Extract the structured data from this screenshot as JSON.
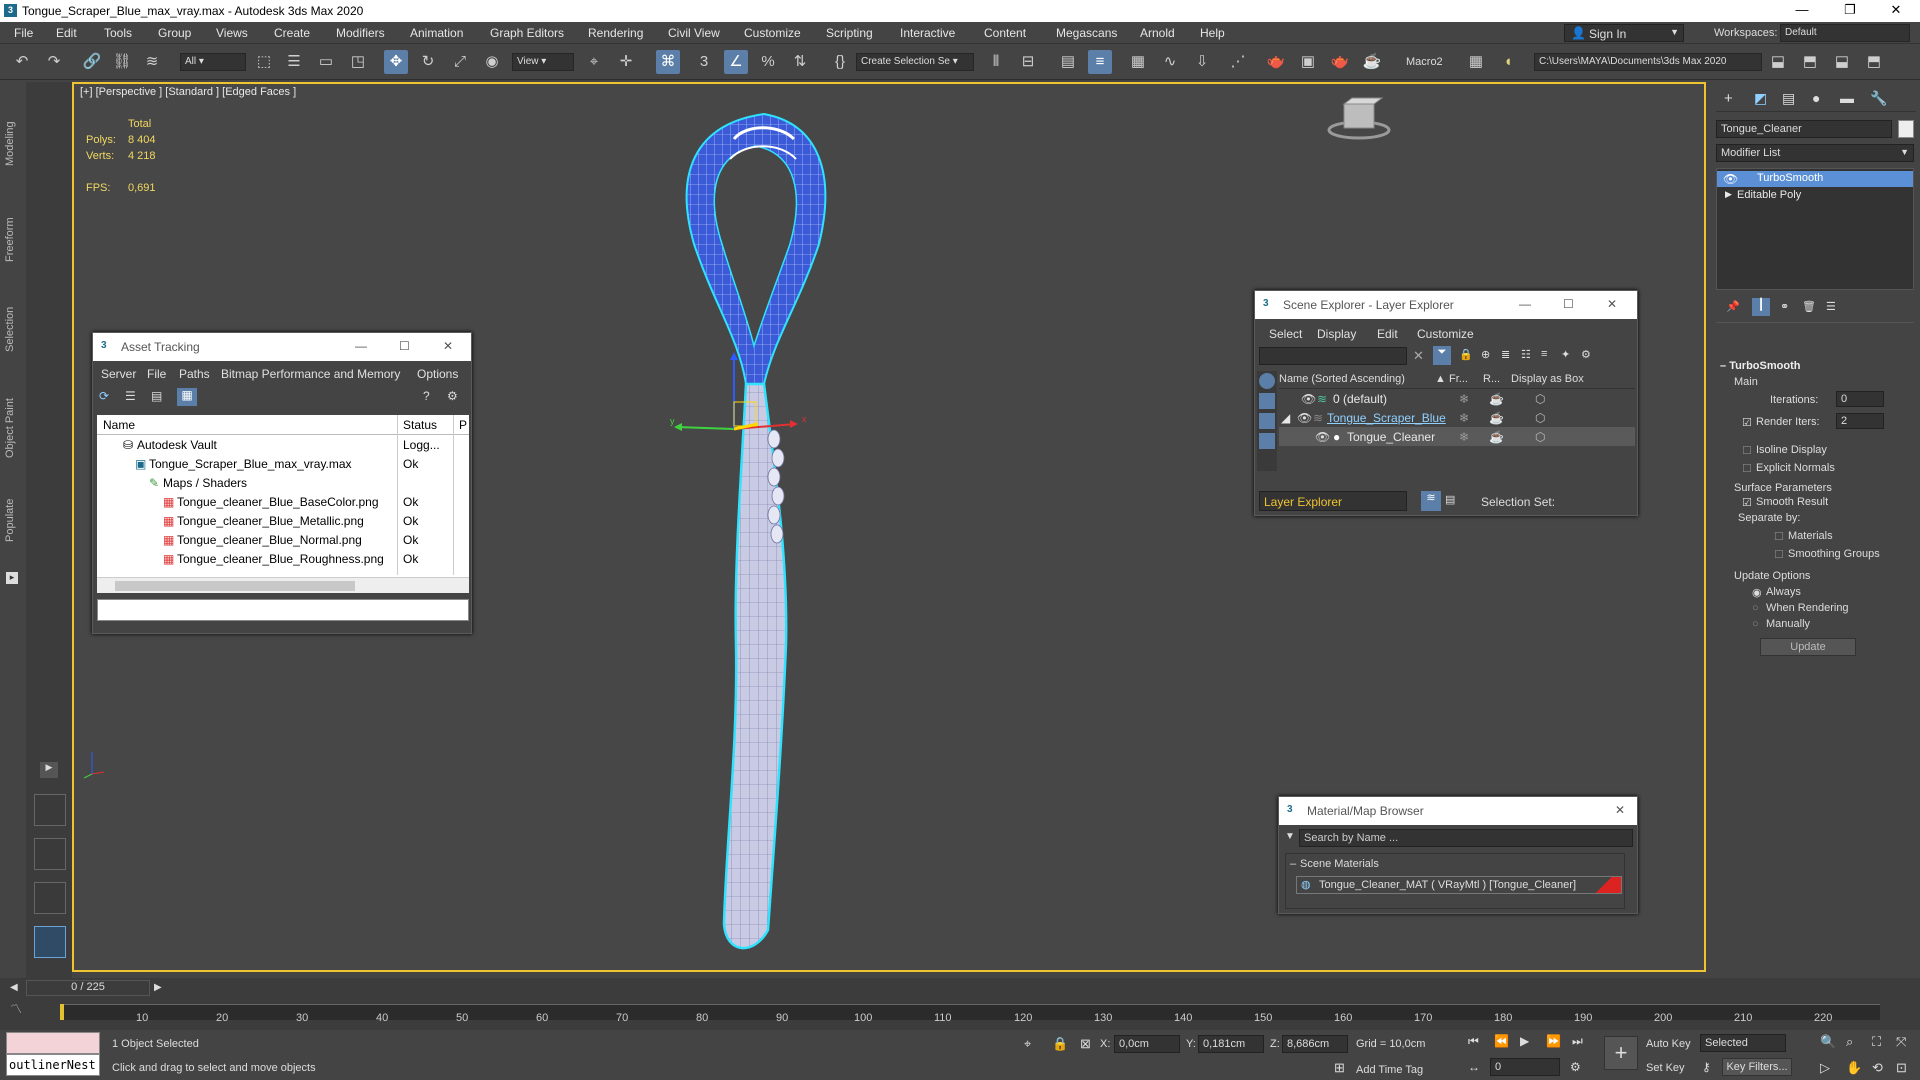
{
  "window": {
    "title": "Tongue_Scraper_Blue_max_vray.max - Autodesk 3ds Max 2020"
  },
  "menu": [
    "File",
    "Edit",
    "Tools",
    "Group",
    "Views",
    "Create",
    "Modifiers",
    "Animation",
    "Graph Editors",
    "Rendering",
    "Civil View",
    "Customize",
    "Scripting",
    "Interactive",
    "Content",
    "Megascans",
    "Arnold",
    "Help"
  ],
  "signin": "Sign In",
  "workspaces_label": "Workspaces:",
  "workspace": "Default",
  "toolbar": {
    "filter": "All",
    "view": "View",
    "selection_set": "Create Selection Se",
    "macro": "Macro2",
    "path": "C:\\Users\\MAYA\\Documents\\3ds Max 2020"
  },
  "side_tabs": [
    "Modeling",
    "Freeform",
    "Selection",
    "Object Paint",
    "Populate"
  ],
  "viewport": {
    "label": "[+] [Perspective ] [Standard ] [Edged Faces ]",
    "stats": {
      "total": "Total",
      "polys_label": "Polys:",
      "polys": "8 404",
      "verts_label": "Verts:",
      "verts": "4 218",
      "fps_label": "FPS:",
      "fps": "0,691"
    }
  },
  "command_panel": {
    "object_name": "Tongue_Cleaner",
    "modifier_list": "Modifier List",
    "stack": [
      "TurboSmooth",
      "Editable Poly"
    ],
    "turbosmooth": {
      "title": "TurboSmooth",
      "main": "Main",
      "iterations_label": "Iterations:",
      "iterations": "0",
      "render_iters_label": "Render Iters:",
      "render_iters": "2",
      "isoline": "Isoline Display",
      "explicit": "Explicit Normals",
      "surface": "Surface Parameters",
      "smooth_result": "Smooth Result",
      "separate_by": "Separate by:",
      "materials": "Materials",
      "smoothing_groups": "Smoothing Groups",
      "update_options": "Update Options",
      "always": "Always",
      "when_rendering": "When Rendering",
      "manually": "Manually",
      "update": "Update"
    }
  },
  "asset_tracking": {
    "title": "Asset Tracking",
    "menu": [
      "Server",
      "File",
      "Paths",
      "Bitmap Performance and Memory",
      "Options"
    ],
    "col_name": "Name",
    "col_status": "Status",
    "col_p": "P",
    "rows": [
      {
        "name": "Autodesk Vault",
        "status": "Logg..."
      },
      {
        "name": "Tongue_Scraper_Blue_max_vray.max",
        "status": "Ok"
      },
      {
        "name": "Maps / Shaders",
        "status": ""
      },
      {
        "name": "Tongue_cleaner_Blue_BaseColor.png",
        "status": "Ok"
      },
      {
        "name": "Tongue_cleaner_Blue_Metallic.png",
        "status": "Ok"
      },
      {
        "name": "Tongue_cleaner_Blue_Normal.png",
        "status": "Ok"
      },
      {
        "name": "Tongue_cleaner_Blue_Roughness.png",
        "status": "Ok"
      }
    ]
  },
  "scene_explorer": {
    "title": "Scene Explorer - Layer Explorer",
    "menu": [
      "Select",
      "Display",
      "Edit",
      "Customize"
    ],
    "col_name": "Name (Sorted Ascending)",
    "col_fr": "Fr...",
    "col_r": "R...",
    "col_box": "Display as Box",
    "rows": [
      "0 (default)",
      "Tongue_Scraper_Blue",
      "Tongue_Cleaner"
    ],
    "layer_explorer": "Layer Explorer",
    "selection_set": "Selection Set:"
  },
  "material_browser": {
    "title": "Material/Map Browser",
    "search": "Search by Name ...",
    "section": "Scene Materials",
    "item": "Tongue_Cleaner_MAT ( VRayMtl ) [Tongue_Cleaner]"
  },
  "timeline": {
    "frame": "0 / 225",
    "ticks": [
      "10",
      "20",
      "30",
      "40",
      "50",
      "60",
      "70",
      "80",
      "90",
      "100",
      "110",
      "120",
      "130",
      "140",
      "150",
      "160",
      "170",
      "180",
      "190",
      "200",
      "210",
      "220"
    ]
  },
  "status": {
    "script": "outlinerNest",
    "selected": "1 Object Selected",
    "hint": "Click and drag to select and move objects",
    "x_label": "X:",
    "x": "0,0cm",
    "y_label": "Y:",
    "y": "0,181cm",
    "z_label": "Z:",
    "z": "8,686cm",
    "grid": "Grid = 10,0cm",
    "add_time_tag": "Add Time Tag",
    "auto_key": "Auto Key",
    "set_key": "Set Key",
    "selected_dd": "Selected",
    "key_filters": "Key Filters...",
    "frame_field": "0"
  }
}
